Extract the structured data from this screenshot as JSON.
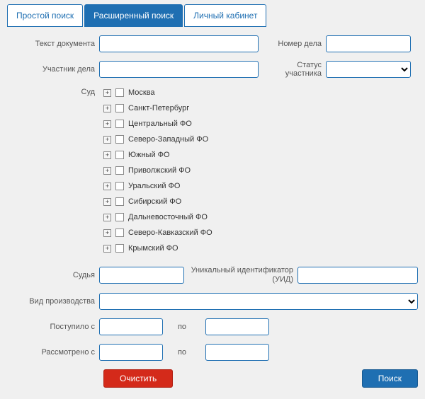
{
  "tabs": [
    {
      "label": "Простой поиск",
      "active": false
    },
    {
      "label": "Расширенный поиск",
      "active": true
    },
    {
      "label": "Личный кабинет",
      "active": false
    }
  ],
  "labels": {
    "doc_text": "Текст документа",
    "case_number": "Номер дела",
    "participant": "Участник дела",
    "participant_status": "Статус участника",
    "court": "Суд",
    "judge": "Судья",
    "uid": "Уникальный идентификатор (УИД)",
    "proceeding_type": "Вид производства",
    "received_from": "Поступило с",
    "received_to": "по",
    "reviewed_from": "Рассмотрено с",
    "reviewed_to": "по"
  },
  "courts": [
    "Москва",
    "Санкт-Петербург",
    "Центральный ФО",
    "Северо-Западный ФО",
    "Южный ФО",
    "Приволжский ФО",
    "Уральский ФО",
    "Сибирский ФО",
    "Дальневосточный ФО",
    "Северо-Кавказский ФО",
    "Крымский ФО"
  ],
  "buttons": {
    "clear": "Очистить",
    "search": "Поиск"
  },
  "values": {
    "doc_text": "",
    "case_number": "",
    "participant": "",
    "participant_status": "",
    "judge": "",
    "uid": "",
    "proceeding_type": "",
    "received_from": "",
    "received_to": "",
    "reviewed_from": "",
    "reviewed_to": ""
  }
}
